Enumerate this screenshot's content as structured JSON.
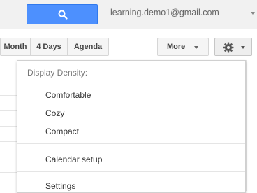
{
  "header": {
    "account_email": "learning.demo1@gmail.com"
  },
  "toolbar": {
    "views": [
      "Month",
      "4 Days",
      "Agenda"
    ],
    "more_label": "More",
    "settings_icon": "gear-icon"
  },
  "settings_menu": {
    "density_header": "Display Density:",
    "density_options": [
      "Comfortable",
      "Cozy",
      "Compact"
    ],
    "calendar_setup_label": "Calendar setup",
    "settings_label": "Settings"
  },
  "colors": {
    "search_button": "#4d90fe",
    "topbar_bg": "#f1f1f1"
  }
}
